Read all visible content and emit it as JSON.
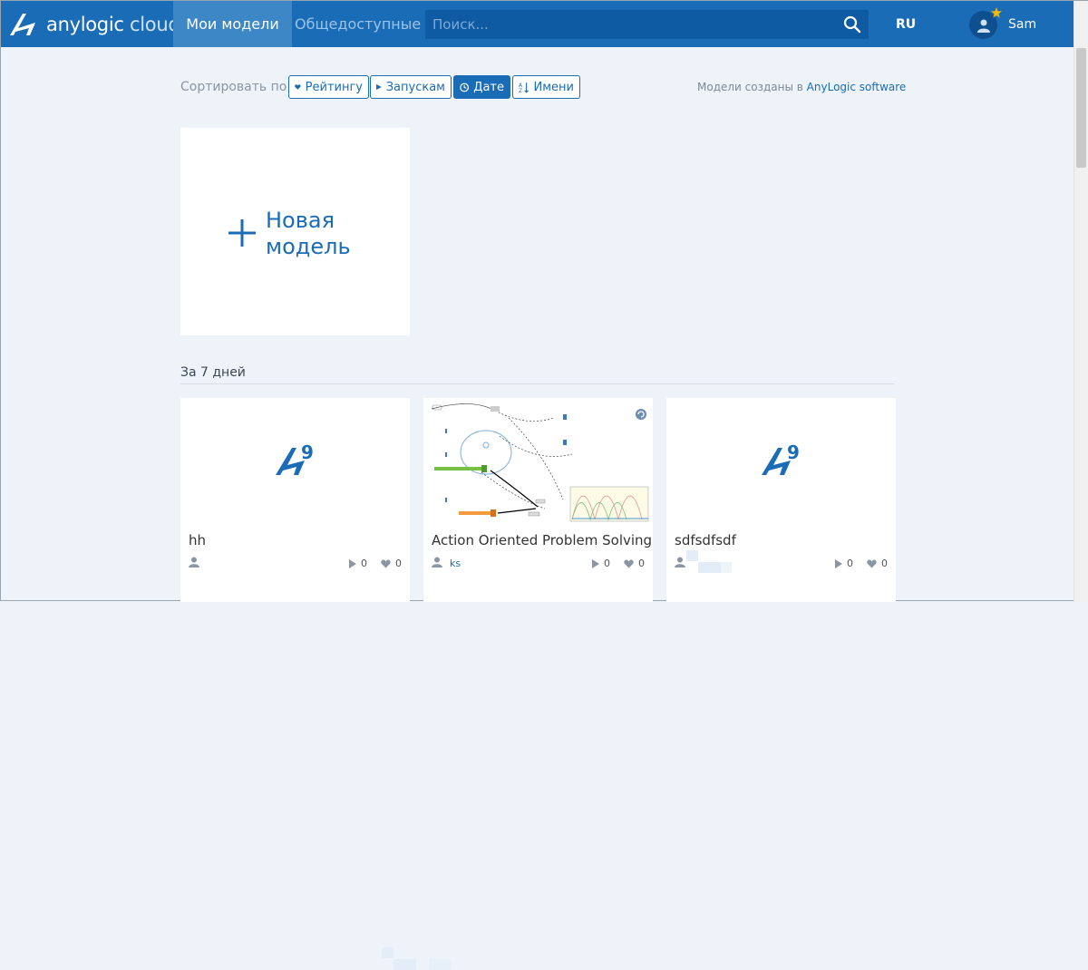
{
  "header": {
    "logo_brand": "anylogic",
    "logo_suffix": "cloud",
    "nav_my_models": "Мои модели",
    "nav_public": "Общедоступные",
    "search_placeholder": "Поиск...",
    "lang": "RU",
    "username": "Sam"
  },
  "sort": {
    "label": "Сортировать по",
    "buttons": [
      {
        "label": "Рейтингу",
        "icon": "heart-icon",
        "active": false
      },
      {
        "label": "Запускам",
        "icon": "play-icon",
        "active": false
      },
      {
        "label": "Дате",
        "icon": "clock-icon",
        "active": true
      },
      {
        "label": "Имени",
        "icon": "sort-alpha-icon",
        "active": false
      }
    ],
    "created_prefix": "Модели созданы в",
    "created_link": "AnyLogic software"
  },
  "new_model": {
    "line1": "Новая",
    "line2": "модель"
  },
  "section_title": "За 7 дней",
  "cards": [
    {
      "title": "hh",
      "author": "",
      "runs": "0",
      "likes": "0",
      "thumb": "anylogic-9-logo"
    },
    {
      "title": "Action Oriented Problem Solving",
      "author": "ks",
      "runs": "0",
      "likes": "0",
      "thumb": "model-diagram"
    },
    {
      "title": "sdfsdfsdf",
      "author": "",
      "runs": "0",
      "likes": "0",
      "thumb": "anylogic-9-logo"
    }
  ],
  "colors": {
    "brand": "#1a6cb6",
    "nav_active": "#3d87c7",
    "search_bg": "#0e5aa3",
    "page_bg": "#eef3fa",
    "star": "#f5b800"
  }
}
